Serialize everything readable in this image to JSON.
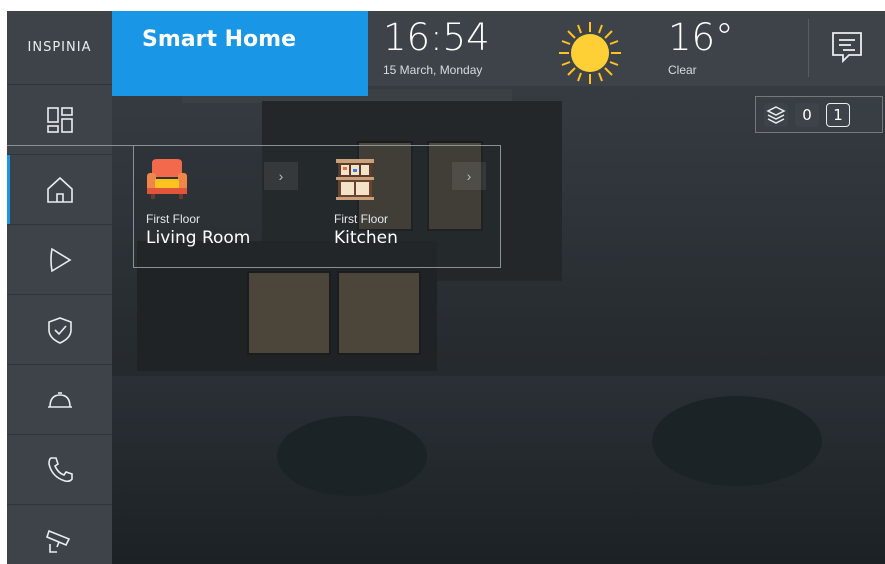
{
  "sidebar": {
    "logo_text": "INSPINIA",
    "items": [
      {
        "icon": "dashboard-icon"
      },
      {
        "icon": "home-icon",
        "active": true
      },
      {
        "icon": "play-icon"
      },
      {
        "icon": "shield-check-icon"
      },
      {
        "icon": "service-bell-icon"
      },
      {
        "icon": "phone-icon"
      },
      {
        "icon": "security-camera-icon"
      }
    ]
  },
  "header": {
    "brand": "Smart Home",
    "time": "16:54",
    "date": "15 March, Monday",
    "weather_icon": "sun-icon",
    "temperature": "16°",
    "condition": "Clear",
    "messages_icon": "message-list-icon"
  },
  "floors": {
    "layers_icon": "layers-icon",
    "options": [
      "0",
      "1"
    ],
    "selected": "1"
  },
  "rooms": [
    {
      "floor": "First Floor",
      "name": "Living Room",
      "icon": "sofa-icon",
      "arrow": "›"
    },
    {
      "floor": "First Floor",
      "name": "Kitchen",
      "icon": "kitchen-cabinet-icon",
      "arrow": "›"
    }
  ],
  "colors": {
    "accent": "#1996e5",
    "sidebar": "#3d4348",
    "sofa": "#f26a4b",
    "sun": "#ffc21f"
  }
}
